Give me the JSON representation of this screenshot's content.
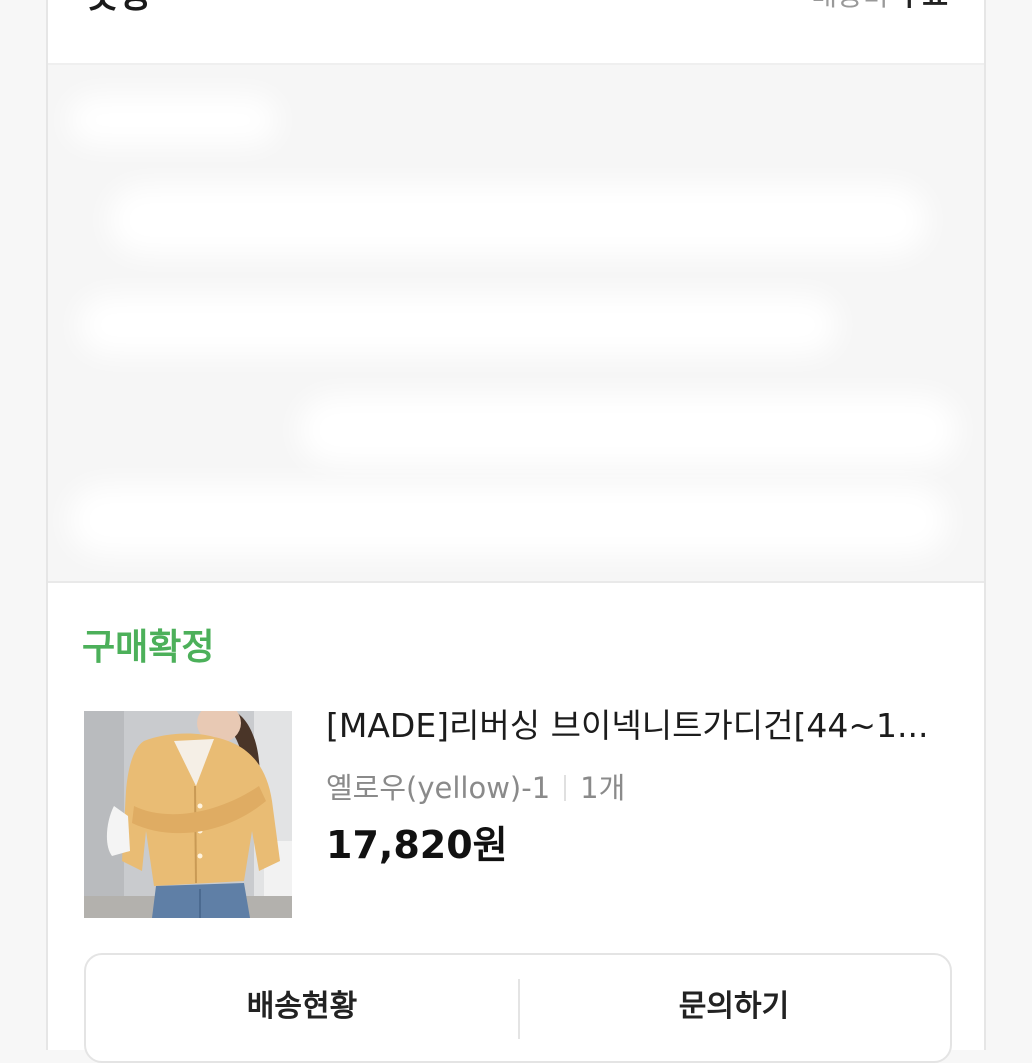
{
  "shop": {
    "name": "옷장"
  },
  "shipping": {
    "label": "배송비",
    "value": "무료"
  },
  "order": {
    "status": "구매확정",
    "status_color": "#4cb05a",
    "product": {
      "name": "[MADE]리버싱 브이넥니트가디건[44~1...",
      "option": "옐로우(yellow)-1",
      "quantity": "1개",
      "price": "17,820원",
      "image_icon": "cardigan-product-photo"
    }
  },
  "actions": {
    "shipping_status": "배송현황",
    "inquiry": "문의하기"
  }
}
